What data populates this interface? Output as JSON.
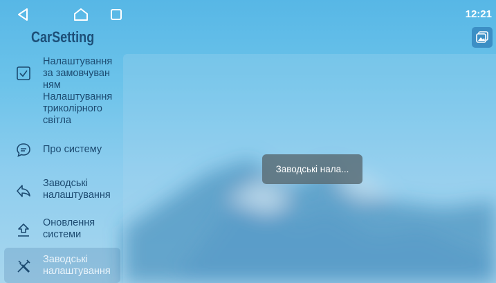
{
  "app": {
    "title": "CarSetting"
  },
  "status_bar": {
    "time": "12:21"
  },
  "nav_buttons": [
    "back",
    "home",
    "recents"
  ],
  "icons": {
    "back": "triangle-back-icon",
    "home": "home-icon",
    "recents": "square-recents-icon",
    "gallery": "image-gallery-icon"
  },
  "sidebar": {
    "items": [
      {
        "label_lines": [
          "Налаштування",
          "за замовчуван",
          "ням",
          "Налаштування",
          "триколірного",
          "світла"
        ],
        "icon": "checkbox-icon",
        "active": false
      },
      {
        "label_lines": [
          "Про систему"
        ],
        "icon": "chat-bubble-icon",
        "active": false
      },
      {
        "label_lines": [
          "Заводські",
          "налаштування"
        ],
        "icon": "back-arrow-icon",
        "active": false
      },
      {
        "label_lines": [
          "Оновлення",
          "системи"
        ],
        "icon": "upload-icon",
        "active": false
      },
      {
        "label_lines": [
          "Заводські",
          "налаштування"
        ],
        "icon": "wrench-screwdriver-icon",
        "active": true
      }
    ]
  },
  "toast": {
    "text": "Заводські нала..."
  },
  "colors": {
    "accent": "#3c8fc5",
    "sidebar_text": "#1c4a70",
    "title": "#1d4f78"
  }
}
